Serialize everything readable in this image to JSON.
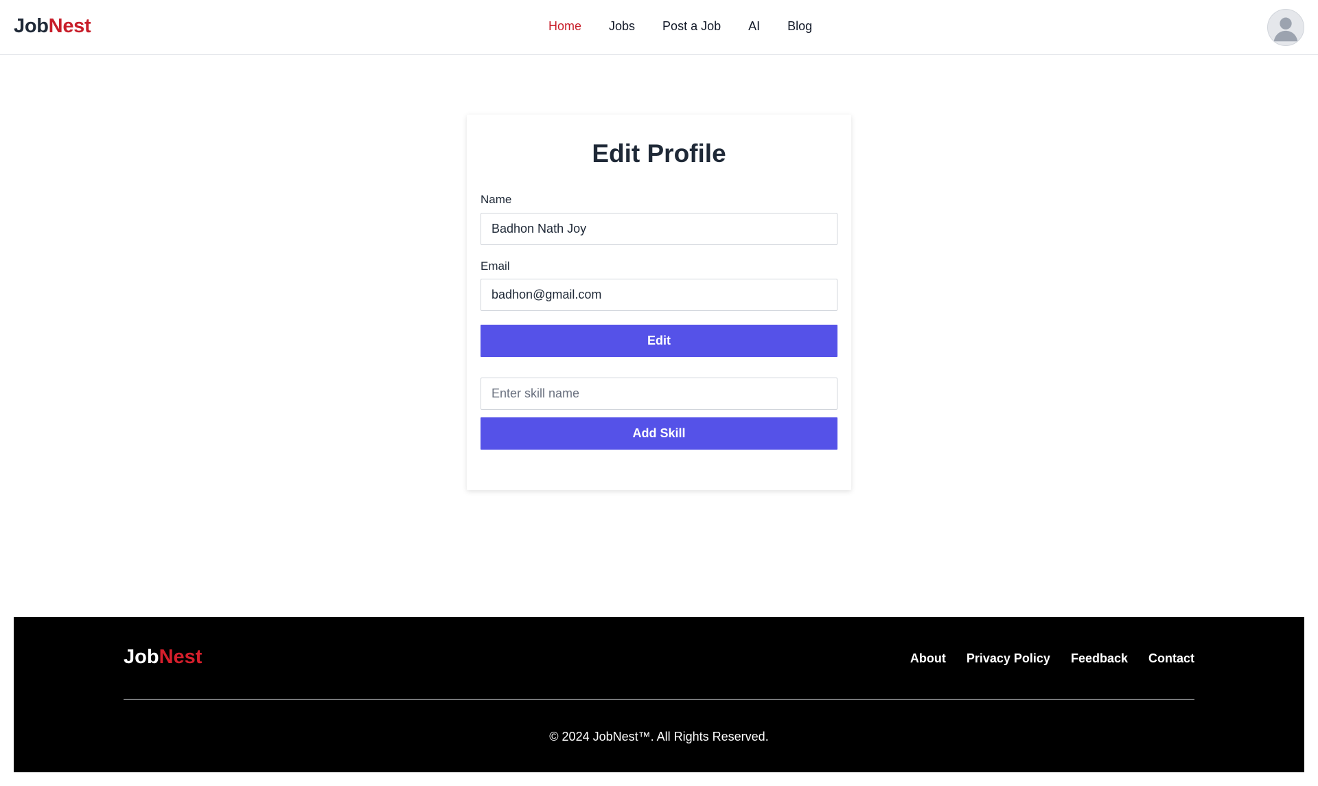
{
  "brand": {
    "part1": "Job",
    "part2": "Nest"
  },
  "nav": {
    "items": [
      {
        "label": "Home",
        "active": true
      },
      {
        "label": "Jobs",
        "active": false
      },
      {
        "label": "Post a Job",
        "active": false
      },
      {
        "label": "AI",
        "active": false
      },
      {
        "label": "Blog",
        "active": false
      }
    ]
  },
  "user": {
    "avatar_icon": "user-avatar-icon"
  },
  "form": {
    "title": "Edit Profile",
    "name_label": "Name",
    "name_value": "Badhon Nath Joy",
    "email_label": "Email",
    "email_value": "badhon@gmail.com",
    "edit_button": "Edit",
    "skill_placeholder": "Enter skill name",
    "add_skill_button": "Add Skill"
  },
  "footer": {
    "links": [
      "About",
      "Privacy Policy",
      "Feedback",
      "Contact"
    ],
    "copyright": "© 2024 JobNest™. All Rights Reserved."
  },
  "colors": {
    "brand_red": "#c81e2a",
    "primary_button": "#5552e8",
    "footer_bg": "#000000"
  }
}
